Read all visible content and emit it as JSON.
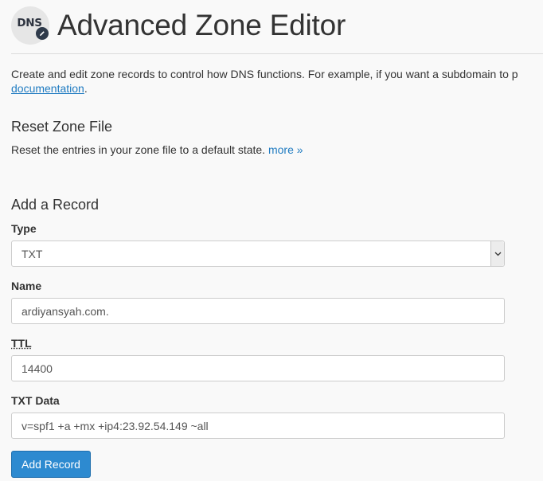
{
  "header": {
    "logo_text": "DNS",
    "title": "Advanced Zone Editor",
    "logo_icon": "dns-edit-icon"
  },
  "intro": {
    "text": "Create and edit zone records to control how DNS functions. For example, if you want a subdomain to p",
    "link_text": "documentation",
    "trailing": "."
  },
  "reset_section": {
    "title": "Reset Zone File",
    "description": "Reset the entries in your zone file to a default state.",
    "more_link": "more »"
  },
  "add_record": {
    "title": "Add a Record",
    "type_label": "Type",
    "type_value": "TXT",
    "name_label": "Name",
    "name_value": "ardiyansyah.com.",
    "ttl_label": "TTL",
    "ttl_value": "14400",
    "txt_label": "TXT Data",
    "txt_value": "v=spf1 +a +mx +ip4:23.92.54.149 ~all",
    "submit_label": "Add Record"
  },
  "colors": {
    "link": "#1f7bc1",
    "button": "#2d8ad0",
    "background": "#f9f9f9"
  }
}
